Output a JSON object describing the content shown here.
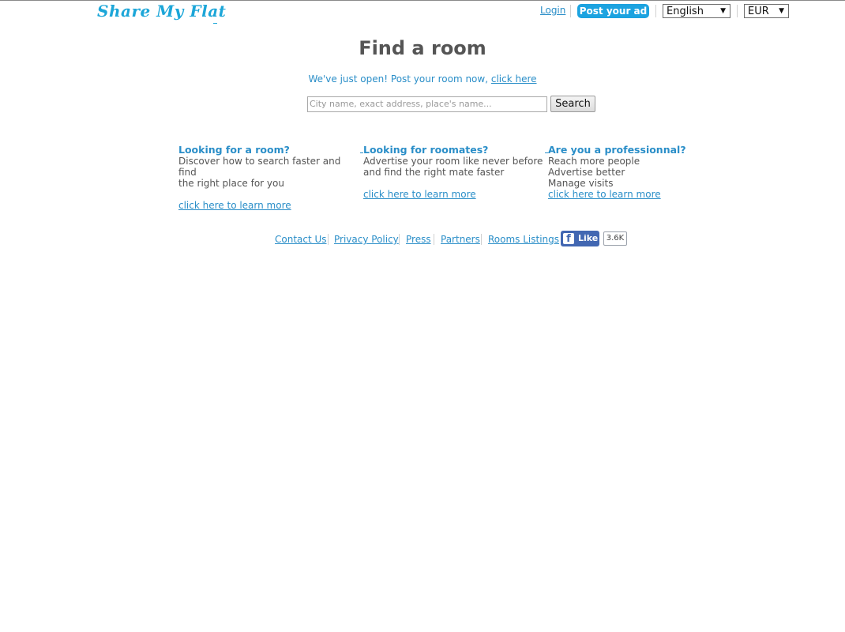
{
  "header": {
    "logo": "Share My Flat",
    "login": "Login",
    "post_ad": "Post your ad",
    "language": "English",
    "currency": "EUR"
  },
  "main": {
    "title": "Find a room",
    "subtitle_prefix": "We've just open! Post your room now, ",
    "subtitle_link": "click here",
    "search_placeholder": "City name, exact address, place's name...",
    "search_button": "Search"
  },
  "columns": [
    {
      "heading": "Looking for a room?",
      "lines": [
        "Discover how to search faster and find",
        "the right place for you"
      ],
      "link": "click here to learn more"
    },
    {
      "heading": "Looking for roomates?",
      "lines": [
        "Advertise your room like never before",
        "and find the right mate faster"
      ],
      "link": "click here to learn more"
    },
    {
      "heading": "Are you a professionnal?",
      "lines": [
        "Reach more people",
        "Advertise better",
        "Manage visits"
      ],
      "link": "click here to learn more"
    }
  ],
  "footer": {
    "links": [
      "Contact Us",
      "Privacy Policy",
      "Press",
      "Partners",
      "Rooms Listings"
    ],
    "fb_like": "Like",
    "fb_count": "3.6K"
  },
  "colors": {
    "accent": "#1ca6d8",
    "link": "#2a8ec8",
    "facebook": "#4267b2"
  }
}
